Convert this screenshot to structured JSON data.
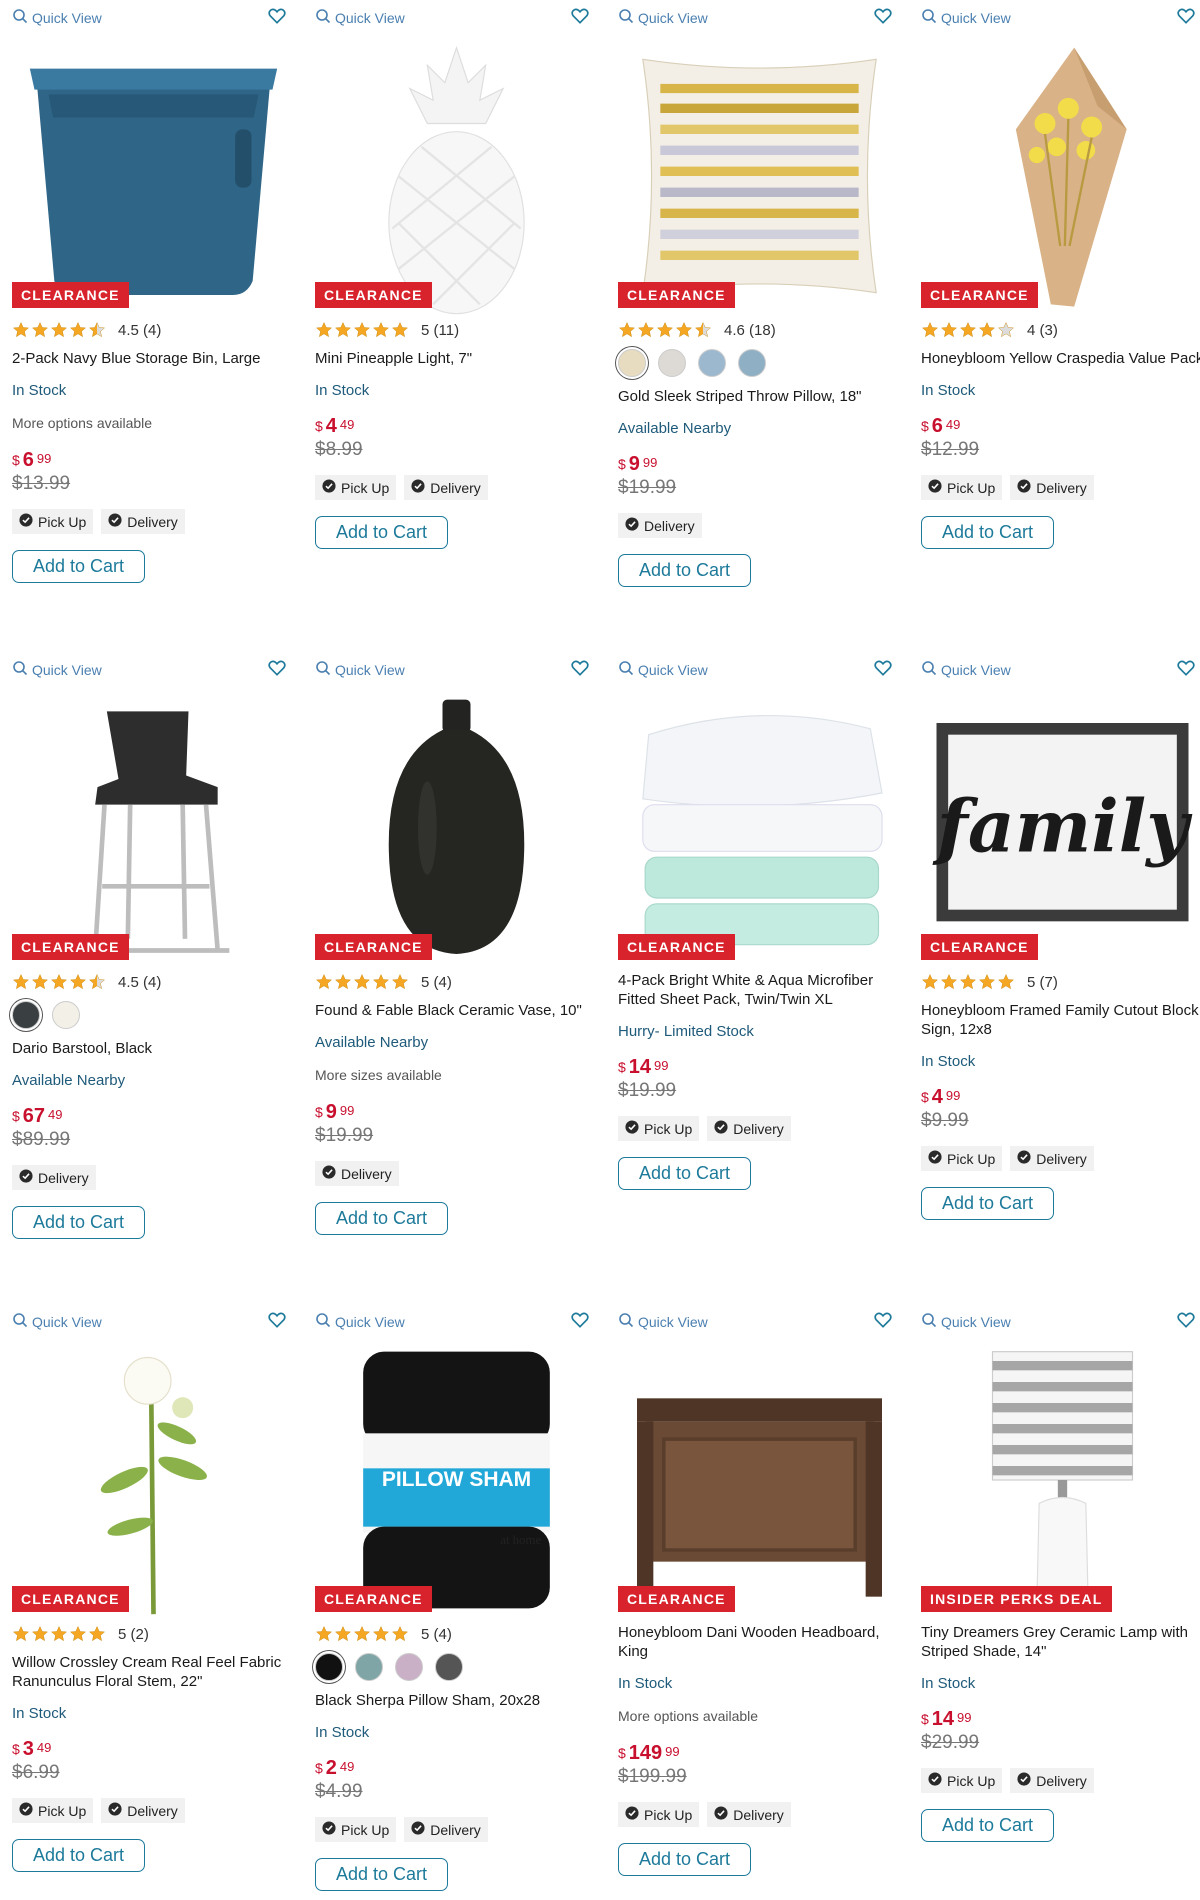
{
  "quick_view_label": "Quick View",
  "add_to_cart_label": "Add to Cart",
  "pickup_label": "Pick Up",
  "delivery_label": "Delivery",
  "colors": {
    "accent": "#1d7a9a",
    "sale": "#c8102e",
    "badge": "#d8222c",
    "star": "#f5a623"
  },
  "products": [
    {
      "badge": "CLEARANCE",
      "stars": 4.5,
      "rating_text": "4.5 (4)",
      "title": "2-Pack Navy Blue Storage Bin, Large",
      "availability": "In Stock",
      "more": "More options available",
      "price_cur": "$",
      "price_whole": "6",
      "price_cents": "99",
      "was": "$13.99",
      "fulfillment": [
        "Pick Up",
        "Delivery"
      ],
      "image": "storage-bin"
    },
    {
      "badge": "CLEARANCE",
      "stars": 5,
      "rating_text": "5 (11)",
      "title": "Mini Pineapple Light, 7\"",
      "availability": "In Stock",
      "price_cur": "$",
      "price_whole": "4",
      "price_cents": "49",
      "was": "$8.99",
      "fulfillment": [
        "Pick Up",
        "Delivery"
      ],
      "image": "pineapple"
    },
    {
      "badge": "CLEARANCE",
      "stars": 4.5,
      "rating_text": "4.6 (18)",
      "swatches": [
        "#e8dcc0",
        "#dddad5",
        "#9cb8cf",
        "#8fb0c4"
      ],
      "title": "Gold Sleek Striped Throw Pillow, 18\"",
      "availability": "Available Nearby",
      "price_cur": "$",
      "price_whole": "9",
      "price_cents": "99",
      "was": "$19.99",
      "fulfillment": [
        "Delivery"
      ],
      "image": "pillow"
    },
    {
      "badge": "CLEARANCE",
      "stars": 4,
      "rating_text": "4 (3)",
      "title": "Honeybloom Yellow Craspedia Value Pack",
      "availability": "In Stock",
      "price_cur": "$",
      "price_whole": "6",
      "price_cents": "49",
      "was": "$12.99",
      "fulfillment": [
        "Pick Up",
        "Delivery"
      ],
      "image": "craspedia"
    },
    {
      "badge": "CLEARANCE",
      "stars": 4.5,
      "rating_text": "4.5 (4)",
      "swatches": [
        "#3a3f42",
        "#f3f0e8"
      ],
      "title": "Dario Barstool, Black",
      "availability": "Available Nearby",
      "price_cur": "$",
      "price_whole": "67",
      "price_cents": "49",
      "was": "$89.99",
      "fulfillment": [
        "Delivery"
      ],
      "image": "barstool"
    },
    {
      "badge": "CLEARANCE",
      "stars": 5,
      "rating_text": "5 (4)",
      "title": "Found & Fable Black Ceramic Vase, 10\"",
      "availability": "Available Nearby",
      "more": "More sizes available",
      "price_cur": "$",
      "price_whole": "9",
      "price_cents": "99",
      "was": "$19.99",
      "fulfillment": [
        "Delivery"
      ],
      "image": "vase"
    },
    {
      "badge": "CLEARANCE",
      "stars": 0,
      "rating_text": "",
      "title": "4-Pack Bright White & Aqua Microfiber Fitted Sheet Pack, Twin/Twin XL",
      "availability": "Hurry- Limited Stock",
      "price_cur": "$",
      "price_whole": "14",
      "price_cents": "99",
      "was": "$19.99",
      "fulfillment": [
        "Pick Up",
        "Delivery"
      ],
      "image": "sheets"
    },
    {
      "badge": "CLEARANCE",
      "stars": 5,
      "rating_text": "5 (7)",
      "title": "Honeybloom Framed Family Cutout Block Sign, 12x8",
      "availability": "In Stock",
      "price_cur": "$",
      "price_whole": "4",
      "price_cents": "99",
      "was": "$9.99",
      "fulfillment": [
        "Pick Up",
        "Delivery"
      ],
      "image": "family-sign",
      "sign_text": "family"
    },
    {
      "badge": "CLEARANCE",
      "stars": 5,
      "rating_text": "5 (2)",
      "title": "Willow Crossley Cream Real Feel Fabric Ranunculus Floral Stem, 22\"",
      "availability": "In Stock",
      "price_cur": "$",
      "price_whole": "3",
      "price_cents": "49",
      "was": "$6.99",
      "fulfillment": [
        "Pick Up",
        "Delivery"
      ],
      "image": "ranunculus"
    },
    {
      "badge": "CLEARANCE",
      "stars": 5,
      "rating_text": "5 (4)",
      "swatches": [
        "#111111",
        "#7fa5a6",
        "#c9b0c7",
        "#555555"
      ],
      "title": "Black Sherpa Pillow Sham, 20x28",
      "availability": "In Stock",
      "price_cur": "$",
      "price_whole": "2",
      "price_cents": "49",
      "was": "$4.99",
      "fulfillment": [
        "Pick Up",
        "Delivery"
      ],
      "image": "pillow-sham",
      "package_text": "PILLOW SHAM",
      "package_brand": "at home"
    },
    {
      "badge": "CLEARANCE",
      "stars": 0,
      "rating_text": "",
      "title": "Honeybloom Dani Wooden Headboard, King",
      "availability": "In Stock",
      "more": "More options available",
      "price_cur": "$",
      "price_whole": "149",
      "price_cents": "99",
      "was": "$199.99",
      "fulfillment": [
        "Pick Up",
        "Delivery"
      ],
      "image": "headboard"
    },
    {
      "badge": "INSIDER PERKS DEAL",
      "stars": 0,
      "rating_text": "",
      "title": "Tiny Dreamers Grey Ceramic Lamp with Striped Shade, 14\"",
      "availability": "In Stock",
      "price_cur": "$",
      "price_whole": "14",
      "price_cents": "99",
      "was": "$29.99",
      "fulfillment": [
        "Pick Up",
        "Delivery"
      ],
      "image": "lamp"
    }
  ]
}
